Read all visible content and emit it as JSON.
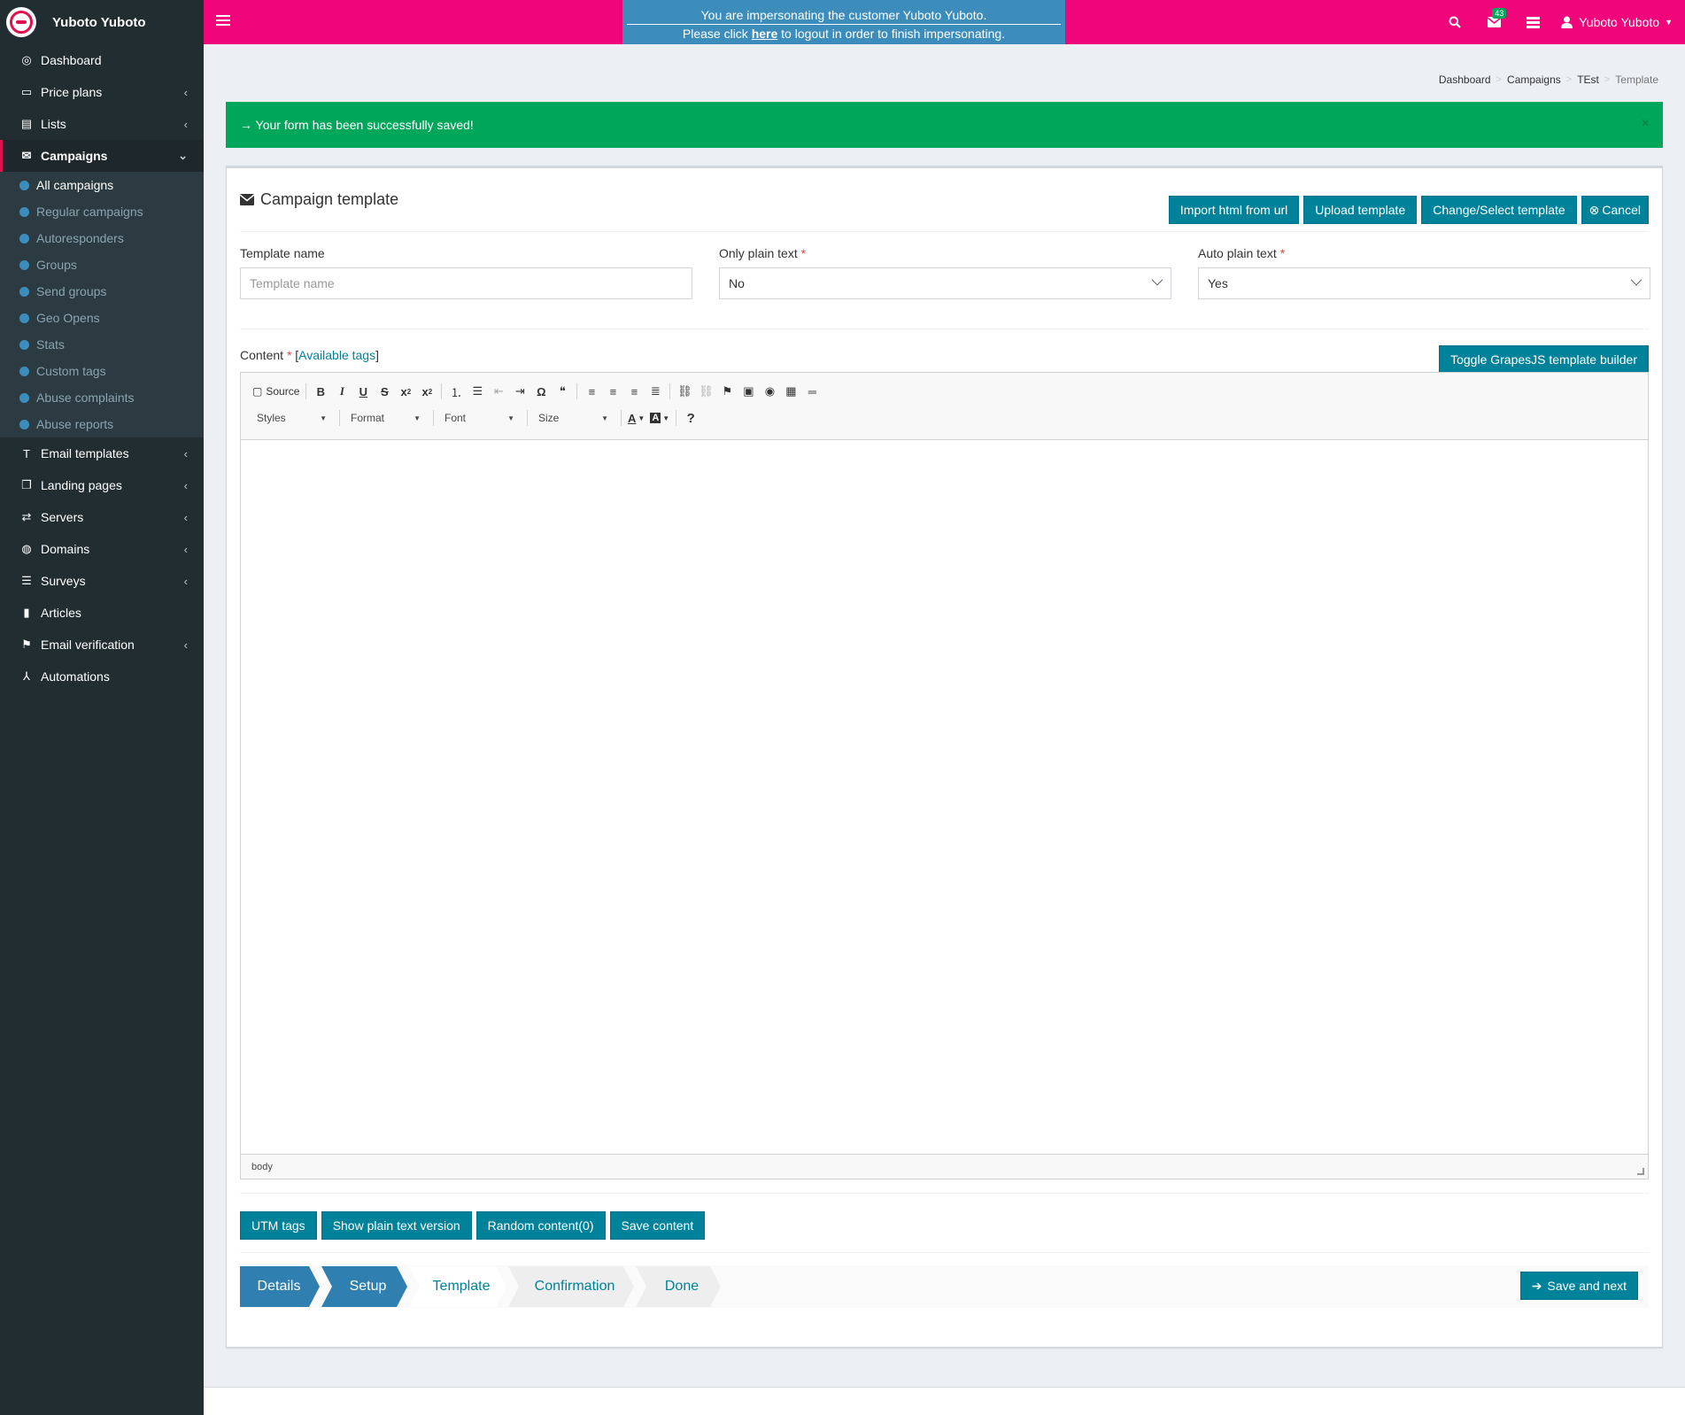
{
  "brand": {
    "name": "Yuboto Yuboto"
  },
  "sidebar": {
    "items": [
      {
        "label": "Dashboard",
        "icon": "dashboard-icon",
        "glyph": "◎"
      },
      {
        "label": "Price plans",
        "icon": "credit-card-icon",
        "glyph": "▭",
        "caret": "‹"
      },
      {
        "label": "Lists",
        "icon": "list-icon",
        "glyph": "▤",
        "caret": "‹"
      },
      {
        "label": "Campaigns",
        "icon": "envelope-icon",
        "glyph": "✉",
        "caret": "⌄"
      },
      {
        "label": "Email templates",
        "icon": "text-icon",
        "glyph": "T",
        "caret": "‹"
      },
      {
        "label": "Landing pages",
        "icon": "pages-icon",
        "glyph": "❐",
        "caret": "‹"
      },
      {
        "label": "Servers",
        "icon": "exchange-icon",
        "glyph": "⇄",
        "caret": "‹"
      },
      {
        "label": "Domains",
        "icon": "globe-icon",
        "glyph": "◍",
        "caret": "‹"
      },
      {
        "label": "Surveys",
        "icon": "list-icon",
        "glyph": "☰",
        "caret": "‹"
      },
      {
        "label": "Articles",
        "icon": "book-icon",
        "glyph": "▮"
      },
      {
        "label": "Email verification",
        "icon": "flag-check-icon",
        "glyph": "⚑",
        "caret": "‹"
      },
      {
        "label": "Automations",
        "icon": "automation-icon",
        "glyph": "⅄"
      }
    ],
    "campaigns_sub": [
      "All campaigns",
      "Regular campaigns",
      "Autoresponders",
      "Groups",
      "Send groups",
      "Geo Opens",
      "Stats",
      "Custom tags",
      "Abuse complaints",
      "Abuse reports"
    ]
  },
  "topbar": {
    "impersonate_line1": "You are impersonating the customer Yuboto Yuboto.",
    "impersonate_pre": "Please click ",
    "impersonate_link": "here",
    "impersonate_post": " to logout in order to finish impersonating.",
    "messages_count": "43",
    "user_name": "Yuboto Yuboto"
  },
  "breadcrumb": {
    "items": [
      "Dashboard",
      "Campaigns",
      "TEst"
    ],
    "current": "Template"
  },
  "alert": {
    "text": "→ Your form has been successfully saved!",
    "close": "×"
  },
  "box": {
    "title": "Campaign template",
    "buttons": {
      "import_url": "Import html from url",
      "upload": "Upload template",
      "change_select": "Change/Select template",
      "cancel": "Cancel"
    }
  },
  "form": {
    "template_name_label": "Template name",
    "template_name_placeholder": "Template name",
    "only_plain_label": "Only plain text",
    "only_plain_value": "No",
    "auto_plain_label": "Auto plain text",
    "auto_plain_value": "Yes",
    "required_mark": "*"
  },
  "content_section": {
    "label": "Content",
    "tags_open": " [",
    "tags_link": "Available tags",
    "tags_close": "]",
    "toggle_button": "Toggle GrapesJS template builder"
  },
  "editor": {
    "source": "Source",
    "combos": [
      "Styles",
      "Format",
      "Font",
      "Size"
    ],
    "path": "body"
  },
  "actions": {
    "utm": "UTM tags",
    "plain": "Show plain text version",
    "random": "Random content(0)",
    "save_content": "Save content"
  },
  "wizard": {
    "steps": [
      "Details",
      "Setup",
      "Template",
      "Confirmation",
      "Done"
    ],
    "save_next": "Save and next"
  },
  "colors": {
    "topbar": "#f0067a",
    "sidebar": "#222d32",
    "accent_button": "#00829b",
    "success": "#00a65a",
    "impersonate_bg": "#3c8dbc"
  }
}
